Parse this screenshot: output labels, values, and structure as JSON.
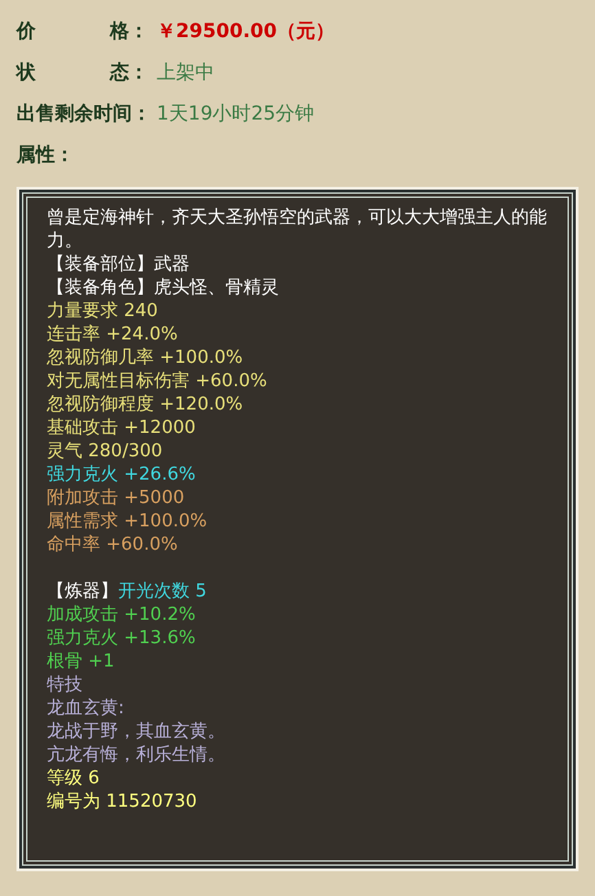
{
  "fields": [
    {
      "label_parts": [
        "价",
        "格："
      ],
      "value": "￥29500.00（元）",
      "kind": "price"
    },
    {
      "label_parts": [
        "状",
        "态："
      ],
      "value": "上架中",
      "kind": "plain"
    },
    {
      "label_parts": [
        "出售剩余时间："
      ],
      "value": "1天19小时25分钟",
      "kind": "plain"
    },
    {
      "label_parts": [
        "属性："
      ]
    }
  ],
  "attributes": [
    {
      "segments": [
        {
          "text": "曾是定海神针，齐天大圣孙悟空的武器，可以大大增强主人的能力。",
          "color": "#ffffff"
        }
      ]
    },
    {
      "segments": [
        {
          "text": "【装备部位】武器",
          "color": "#ffffff"
        }
      ]
    },
    {
      "segments": [
        {
          "text": "【装备角色】虎头怪、骨精灵",
          "color": "#ffffff"
        }
      ]
    },
    {
      "segments": [
        {
          "text": "力量要求 240",
          "color": "#e8e07a"
        }
      ]
    },
    {
      "segments": [
        {
          "text": "连击率 +24.0%",
          "color": "#e8e07a"
        }
      ]
    },
    {
      "segments": [
        {
          "text": "忽视防御几率 +100.0%",
          "color": "#e8e07a"
        }
      ]
    },
    {
      "segments": [
        {
          "text": "对无属性目标伤害 +60.0%",
          "color": "#e8e07a"
        }
      ]
    },
    {
      "segments": [
        {
          "text": "忽视防御程度 +120.0%",
          "color": "#e8e07a"
        }
      ]
    },
    {
      "segments": [
        {
          "text": "基础攻击 +12000",
          "color": "#e8e07a"
        }
      ]
    },
    {
      "segments": [
        {
          "text": "灵气 280/300",
          "color": "#e8e07a"
        }
      ]
    },
    {
      "segments": [
        {
          "text": "强力克火 +26.6%",
          "color": "#40d8e0"
        }
      ]
    },
    {
      "segments": [
        {
          "text": "附加攻击 +5000",
          "color": "#d8a060"
        }
      ]
    },
    {
      "segments": [
        {
          "text": "属性需求 +100.0%",
          "color": "#d8a060"
        }
      ]
    },
    {
      "segments": [
        {
          "text": "命中率 +60.0%",
          "color": "#d8a060"
        }
      ]
    },
    {
      "kind": "blank"
    },
    {
      "segments": [
        {
          "text": "【炼器】",
          "color": "#ffffff"
        },
        {
          "text": "开光次数 5",
          "color": "#40d8e0"
        }
      ]
    },
    {
      "segments": [
        {
          "text": "加成攻击 +10.2%",
          "color": "#50d050"
        }
      ]
    },
    {
      "segments": [
        {
          "text": "强力克火 +13.6%",
          "color": "#50d050"
        }
      ]
    },
    {
      "segments": [
        {
          "text": "根骨 +1",
          "color": "#50d050"
        }
      ]
    },
    {
      "segments": [
        {
          "text": "特技",
          "color": "#b8b0d8"
        }
      ]
    },
    {
      "segments": [
        {
          "text": "龙血玄黄:",
          "color": "#b8b0d8"
        }
      ]
    },
    {
      "segments": [
        {
          "text": "龙战于野，其血玄黄。",
          "color": "#b8b0d8"
        }
      ]
    },
    {
      "segments": [
        {
          "text": "亢龙有悔，利乐生情。",
          "color": "#b8b0d8"
        }
      ]
    },
    {
      "segments": [
        {
          "text": "等级 6",
          "color": "#ffff80"
        }
      ]
    },
    {
      "segments": [
        {
          "text": "编号为 11520730",
          "color": "#ffff80"
        }
      ]
    }
  ]
}
